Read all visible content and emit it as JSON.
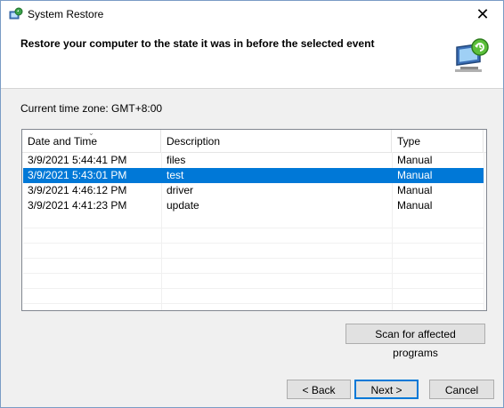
{
  "window": {
    "title": "System Restore",
    "close_glyph": "✕"
  },
  "header": {
    "title": "Restore your computer to the state it was in before the selected event"
  },
  "timezone": "Current time zone: GMT+8:00",
  "table": {
    "columns": [
      "Date and Time",
      "Description",
      "Type"
    ],
    "rows": [
      {
        "date": "3/9/2021 5:44:41 PM",
        "description": "files",
        "type": "Manual",
        "selected": false
      },
      {
        "date": "3/9/2021 5:43:01 PM",
        "description": "test",
        "type": "Manual",
        "selected": true
      },
      {
        "date": "3/9/2021 4:46:12 PM",
        "description": "driver",
        "type": "Manual",
        "selected": false
      },
      {
        "date": "3/9/2021 4:41:23 PM",
        "description": "update",
        "type": "Manual",
        "selected": false
      }
    ],
    "sort_indicator": "⌄"
  },
  "buttons": {
    "scan": "Scan for affected programs",
    "back": "< Back",
    "next": "Next >",
    "cancel": "Cancel"
  },
  "colors": {
    "selection": "#0078d7",
    "window_border": "#7a9cc5"
  }
}
